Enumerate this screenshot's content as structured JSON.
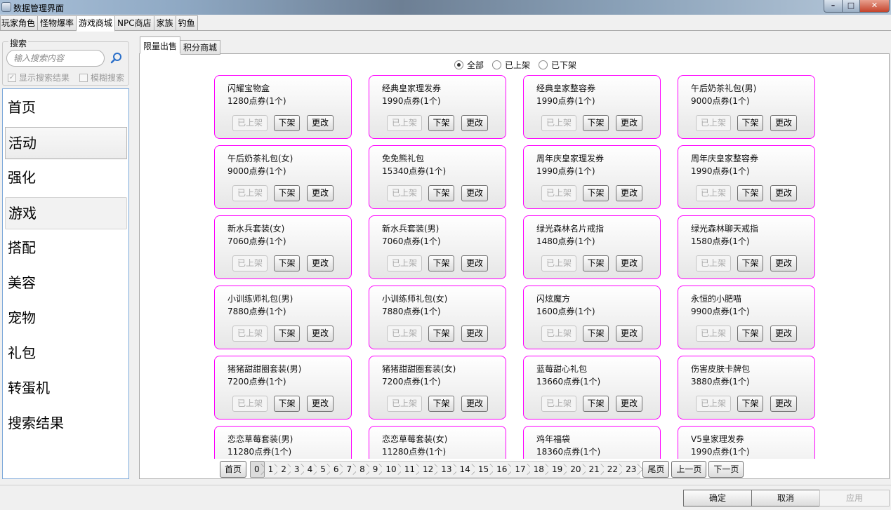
{
  "window": {
    "title": "数据管理界面",
    "min_label": "–",
    "max_label": "□",
    "close_label": "✕"
  },
  "main_tabs": [
    "玩家角色",
    "怪物爆率",
    "游戏商城",
    "NPC商店",
    "家族",
    "钓鱼"
  ],
  "active_main_tab": 2,
  "search": {
    "group_label": "搜索",
    "placeholder": "输入搜索内容",
    "show_results_label": "显示搜索结果",
    "show_results_checked": true,
    "fuzzy_label": "模糊搜索",
    "fuzzy_checked": false
  },
  "categories": [
    "首页",
    "活动",
    "强化",
    "游戏",
    "搭配",
    "美容",
    "宠物",
    "礼包",
    "转蛋机",
    "搜索结果"
  ],
  "selected_category": 1,
  "hover_category": 3,
  "sub_tabs": [
    "限量出售",
    "积分商城"
  ],
  "active_sub_tab": 0,
  "filters": {
    "options": [
      "全部",
      "已上架",
      "已下架"
    ],
    "selected": 0
  },
  "card_buttons": {
    "listed": "已上架",
    "unlist": "下架",
    "edit": "更改"
  },
  "items": [
    {
      "name": "闪耀宝物盒",
      "price": "1280点券(1个)"
    },
    {
      "name": "经典皇家理发券",
      "price": "1990点券(1个)"
    },
    {
      "name": "经典皇家整容券",
      "price": "1990点券(1个)"
    },
    {
      "name": "午后奶茶礼包(男)",
      "price": "9000点券(1个)"
    },
    {
      "name": "午后奶茶礼包(女)",
      "price": "9000点券(1个)"
    },
    {
      "name": "免免熊礼包",
      "price": "15340点券(1个)"
    },
    {
      "name": "周年庆皇家理发券",
      "price": "1990点券(1个)"
    },
    {
      "name": "周年庆皇家整容券",
      "price": "1990点券(1个)"
    },
    {
      "name": "新水兵套装(女)",
      "price": "7060点券(1个)"
    },
    {
      "name": "新水兵套装(男)",
      "price": "7060点券(1个)"
    },
    {
      "name": "绿光森林名片戒指",
      "price": "1480点券(1个)"
    },
    {
      "name": "绿光森林聊天戒指",
      "price": "1580点券(1个)"
    },
    {
      "name": "小训练师礼包(男)",
      "price": "7880点券(1个)"
    },
    {
      "name": "小训练师礼包(女)",
      "price": "7880点券(1个)"
    },
    {
      "name": "闪炫魔方",
      "price": "1600点券(1个)"
    },
    {
      "name": "永恒的小肥喵",
      "price": "9900点券(1个)"
    },
    {
      "name": "猪猪甜甜圈套装(男)",
      "price": "7200点券(1个)"
    },
    {
      "name": "猪猪甜甜圈套装(女)",
      "price": "7200点券(1个)"
    },
    {
      "name": "蓝莓甜心礼包",
      "price": "13660点券(1个)"
    },
    {
      "name": "伤害皮肤卡牌包",
      "price": "3880点券(1个)"
    },
    {
      "name": "恋恋草莓套装(男)",
      "price": "11280点券(1个)"
    },
    {
      "name": "恋恋草莓套装(女)",
      "price": "11280点券(1个)"
    },
    {
      "name": "鸡年福袋",
      "price": "18360点券(1个)"
    },
    {
      "name": "V5皇家理发券",
      "price": "1990点券(1个)"
    }
  ],
  "pager": {
    "first": "首页",
    "last": "尾页",
    "prev": "上一页",
    "next": "下一页",
    "pages": [
      "0",
      "1",
      "2",
      "3",
      "4",
      "5",
      "6",
      "7",
      "8",
      "9",
      "10",
      "11",
      "12",
      "13",
      "14",
      "15",
      "16",
      "17",
      "18",
      "19",
      "20",
      "21",
      "22",
      "23"
    ],
    "current": 0
  },
  "footer": {
    "ok": "确定",
    "cancel": "取消",
    "apply": "应用"
  }
}
